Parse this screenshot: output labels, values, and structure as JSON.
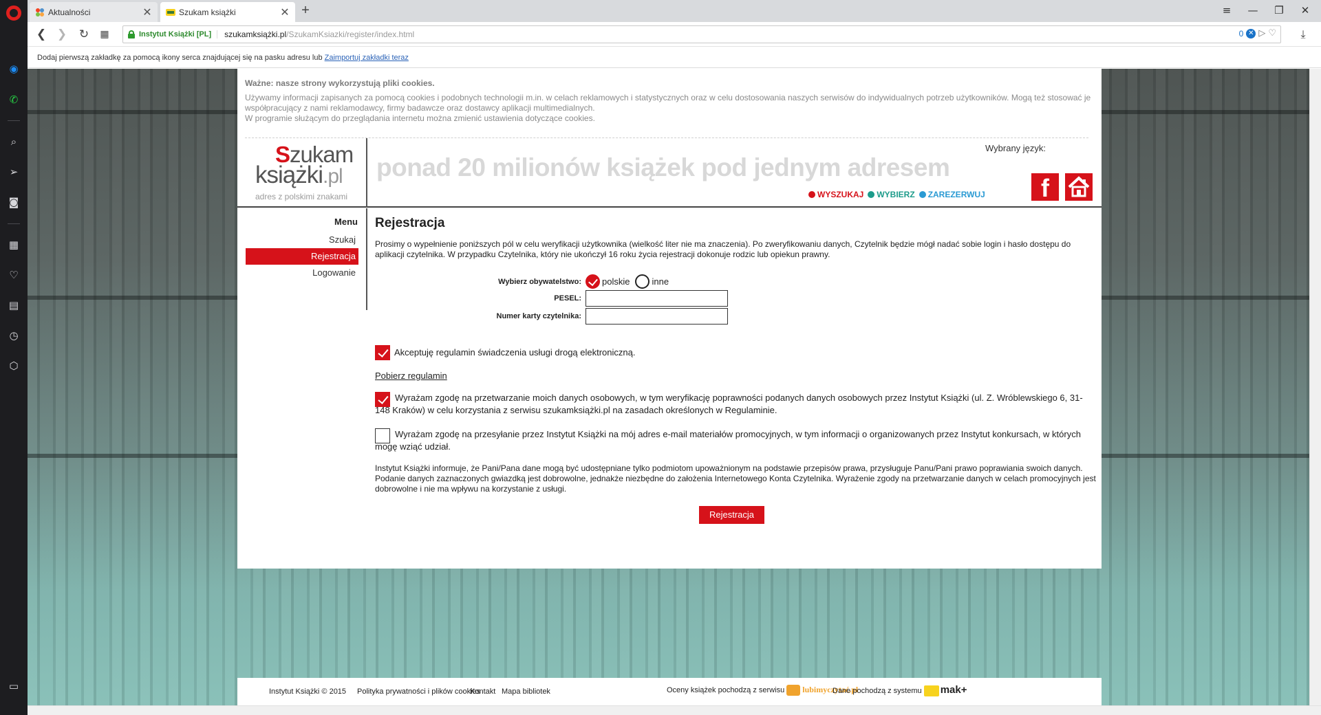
{
  "browser": {
    "tabs": [
      {
        "label": "Aktualności",
        "close": "✕"
      },
      {
        "label": "Szukam książki",
        "close": "✕"
      }
    ],
    "new_tab": "+",
    "site_identity": "Instytut Książki [PL]",
    "url_host": "szukamksiążki.pl",
    "url_path": "/SzukamKsiazki/register/index.html",
    "adblock_count": "0",
    "bookmark_hint": "Dodaj pierwszą zakładkę za pomocą ikony serca znajdującej się na pasku adresu lub",
    "bookmark_link": "Zaimportuj zakładki teraz"
  },
  "cookies": {
    "title": "Ważne: nasze strony wykorzystują pliki cookies.",
    "line1": "Używamy informacji zapisanych za pomocą cookies i podobnych technologii m.in. w celach reklamowych i statystycznych oraz w celu dostosowania naszych serwisów do indywidualnych potrzeb użytkowników. Mogą też stosować je współpracujący z nami reklamodawcy, firmy badawcze oraz dostawcy aplikacji multimedialnych.",
    "line2": "W programie służącym do przeglądania internetu można zmienić ustawienia dotyczące cookies."
  },
  "header": {
    "logo_s": "S",
    "logo_zukam": "zukam",
    "logo_ksiazki": "książki",
    "logo_pl": ".pl",
    "logo_tagline": "adres z polskimi znakami",
    "slogan": "ponad 20 milionów książek pod jednym adresem",
    "steps": [
      {
        "label": "WYSZUKAJ",
        "color": "#d6121a"
      },
      {
        "label": "WYBIERZ",
        "color": "#1c9b8a"
      },
      {
        "label": "ZAREZERWUJ",
        "color": "#2a9ad3"
      }
    ],
    "language_label": "Wybrany język:",
    "facebook_glyph": "f"
  },
  "menu": {
    "title": "Menu",
    "items": [
      {
        "label": "Szukaj",
        "active": false
      },
      {
        "label": "Rejestracja",
        "active": true
      },
      {
        "label": "Logowanie",
        "active": false
      }
    ]
  },
  "main": {
    "title": "Rejestracja",
    "intro": "Prosimy o wypełnienie poniższych pól w celu weryfikacji użytkownika (wielkość liter nie ma znaczenia). Po zweryfikowaniu danych, Czytelnik będzie mógł nadać sobie login i hasło dostępu do aplikacji czytelnika. W przypadku Czytelnika, który nie ukończył 16 roku życia rejestracji dokonuje rodzic lub opiekun prawny.",
    "citizenship_label": "Wybierz obywatelstwo:",
    "citizenship_options": [
      {
        "label": "polskie",
        "selected": true
      },
      {
        "label": "inne",
        "selected": false
      }
    ],
    "pesel_label": "PESEL:",
    "pesel_value": "",
    "card_label": "Numer karty czytelnika:",
    "card_value": "",
    "accept_terms": {
      "label": "Akceptuję regulamin świadczenia usługi drogą elektroniczną.",
      "checked": true
    },
    "download_terms": "Pobierz regulamin",
    "consent_data": {
      "label": "Wyrażam zgodę na przetwarzanie moich danych osobowych, w tym weryfikację poprawności podanych danych osobowych przez Instytut Książki (ul. Z. Wróblewskiego 6, 31-148 Kraków) w celu korzystania z serwisu szukamksiążki.pl na zasadach określonych w Regulaminie.",
      "checked": true
    },
    "consent_marketing": {
      "label": "Wyrażam zgodę na przesyłanie przez Instytut Książki na mój adres e-mail materiałów promocyjnych, w tym informacji o organizowanych przez Instytut konkursach, w których mogę wziąć udział.",
      "checked": false
    },
    "info": "Instytut Książki informuje, że Pani/Pana dane mogą być udostępniane tylko podmiotom upoważnionym na podstawie przepisów prawa, przysługuje Panu/Pani prawo poprawiania swoich danych. Podanie danych zaznaczonych gwiazdką jest dobrowolne, jednakże niezbędne do założenia Internetowego Konta Czytelnika. Wyrażenie zgody na przetwarzanie danych w celach promocyjnych jest dobrowolne i nie ma wpływu na korzystanie z usługi.",
    "submit": "Rejestracja"
  },
  "footer": {
    "copyright": "Instytut Książki © 2015",
    "privacy": "Polityka prywatności i plików cookies",
    "contact": "Kontakt",
    "map": "Mapa bibliotek",
    "ratings_from": "Oceny książek pochodzą z serwisu",
    "lubimyczytac": "lubimyczytać.pl",
    "data_from": "Dane pochodzą z systemu",
    "mak": "mak+"
  }
}
